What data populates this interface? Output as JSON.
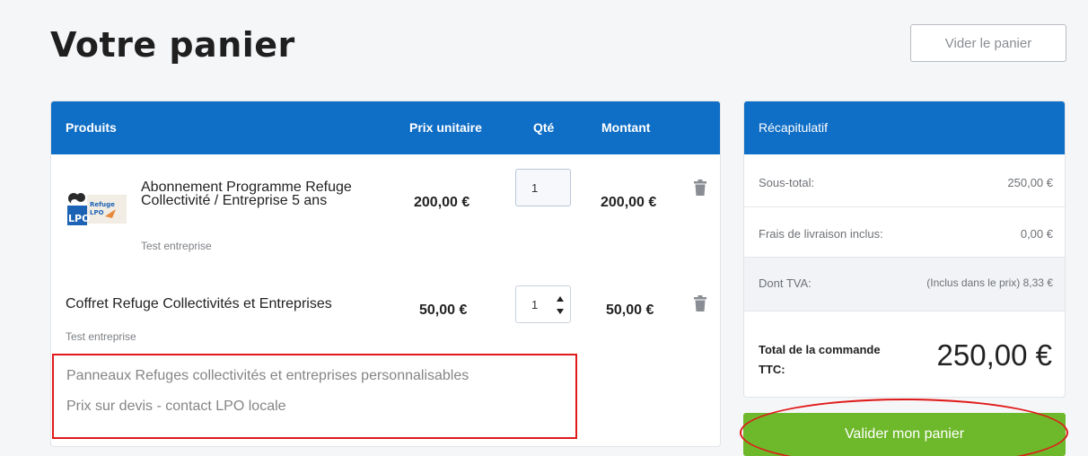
{
  "page": {
    "title": "Votre panier",
    "clear_label": "Vider le panier"
  },
  "products": {
    "headers": {
      "product": "Produits",
      "unit_price": "Prix unitaire",
      "qty": "Qté",
      "amount": "Montant"
    },
    "items": [
      {
        "name": "Abonnement Programme Refuge Collectivité / Entreprise 5 ans",
        "subtitle": "Test entreprise",
        "unit_price": "200,00 €",
        "qty": "1",
        "amount": "200,00 €",
        "logo": {
          "text_main": "LPO",
          "text_side_1": "Refuge",
          "text_side_2": "LPO"
        }
      },
      {
        "name": "Coffret Refuge Collectivités et Entreprises",
        "subtitle": "Test entreprise",
        "unit_price": "50,00 €",
        "qty": "1",
        "amount": "50,00 €"
      }
    ],
    "custom_note": {
      "line1": "Panneaux Refuges collectivités et entreprises personnalisables",
      "line2": "Prix sur devis - contact LPO locale"
    }
  },
  "summary": {
    "title": "Récapitulatif",
    "subtotal_label": "Sous-total:",
    "subtotal_value": "250,00 €",
    "shipping_label": "Frais de livraison inclus:",
    "shipping_value": "0,00 €",
    "vat_label": "Dont TVA:",
    "vat_value": "(Inclus dans le prix) 8,33 €",
    "total_label": "Total de la commande TTC:",
    "total_value": "250,00 €"
  },
  "validate_label": "Valider mon panier",
  "colors": {
    "header_blue": "#0f6ec5",
    "validate_green": "#6eb82b",
    "annotation_red": "#e01919"
  },
  "icons": [
    "trash-icon",
    "lpo-logo",
    "spinner-arrows"
  ]
}
